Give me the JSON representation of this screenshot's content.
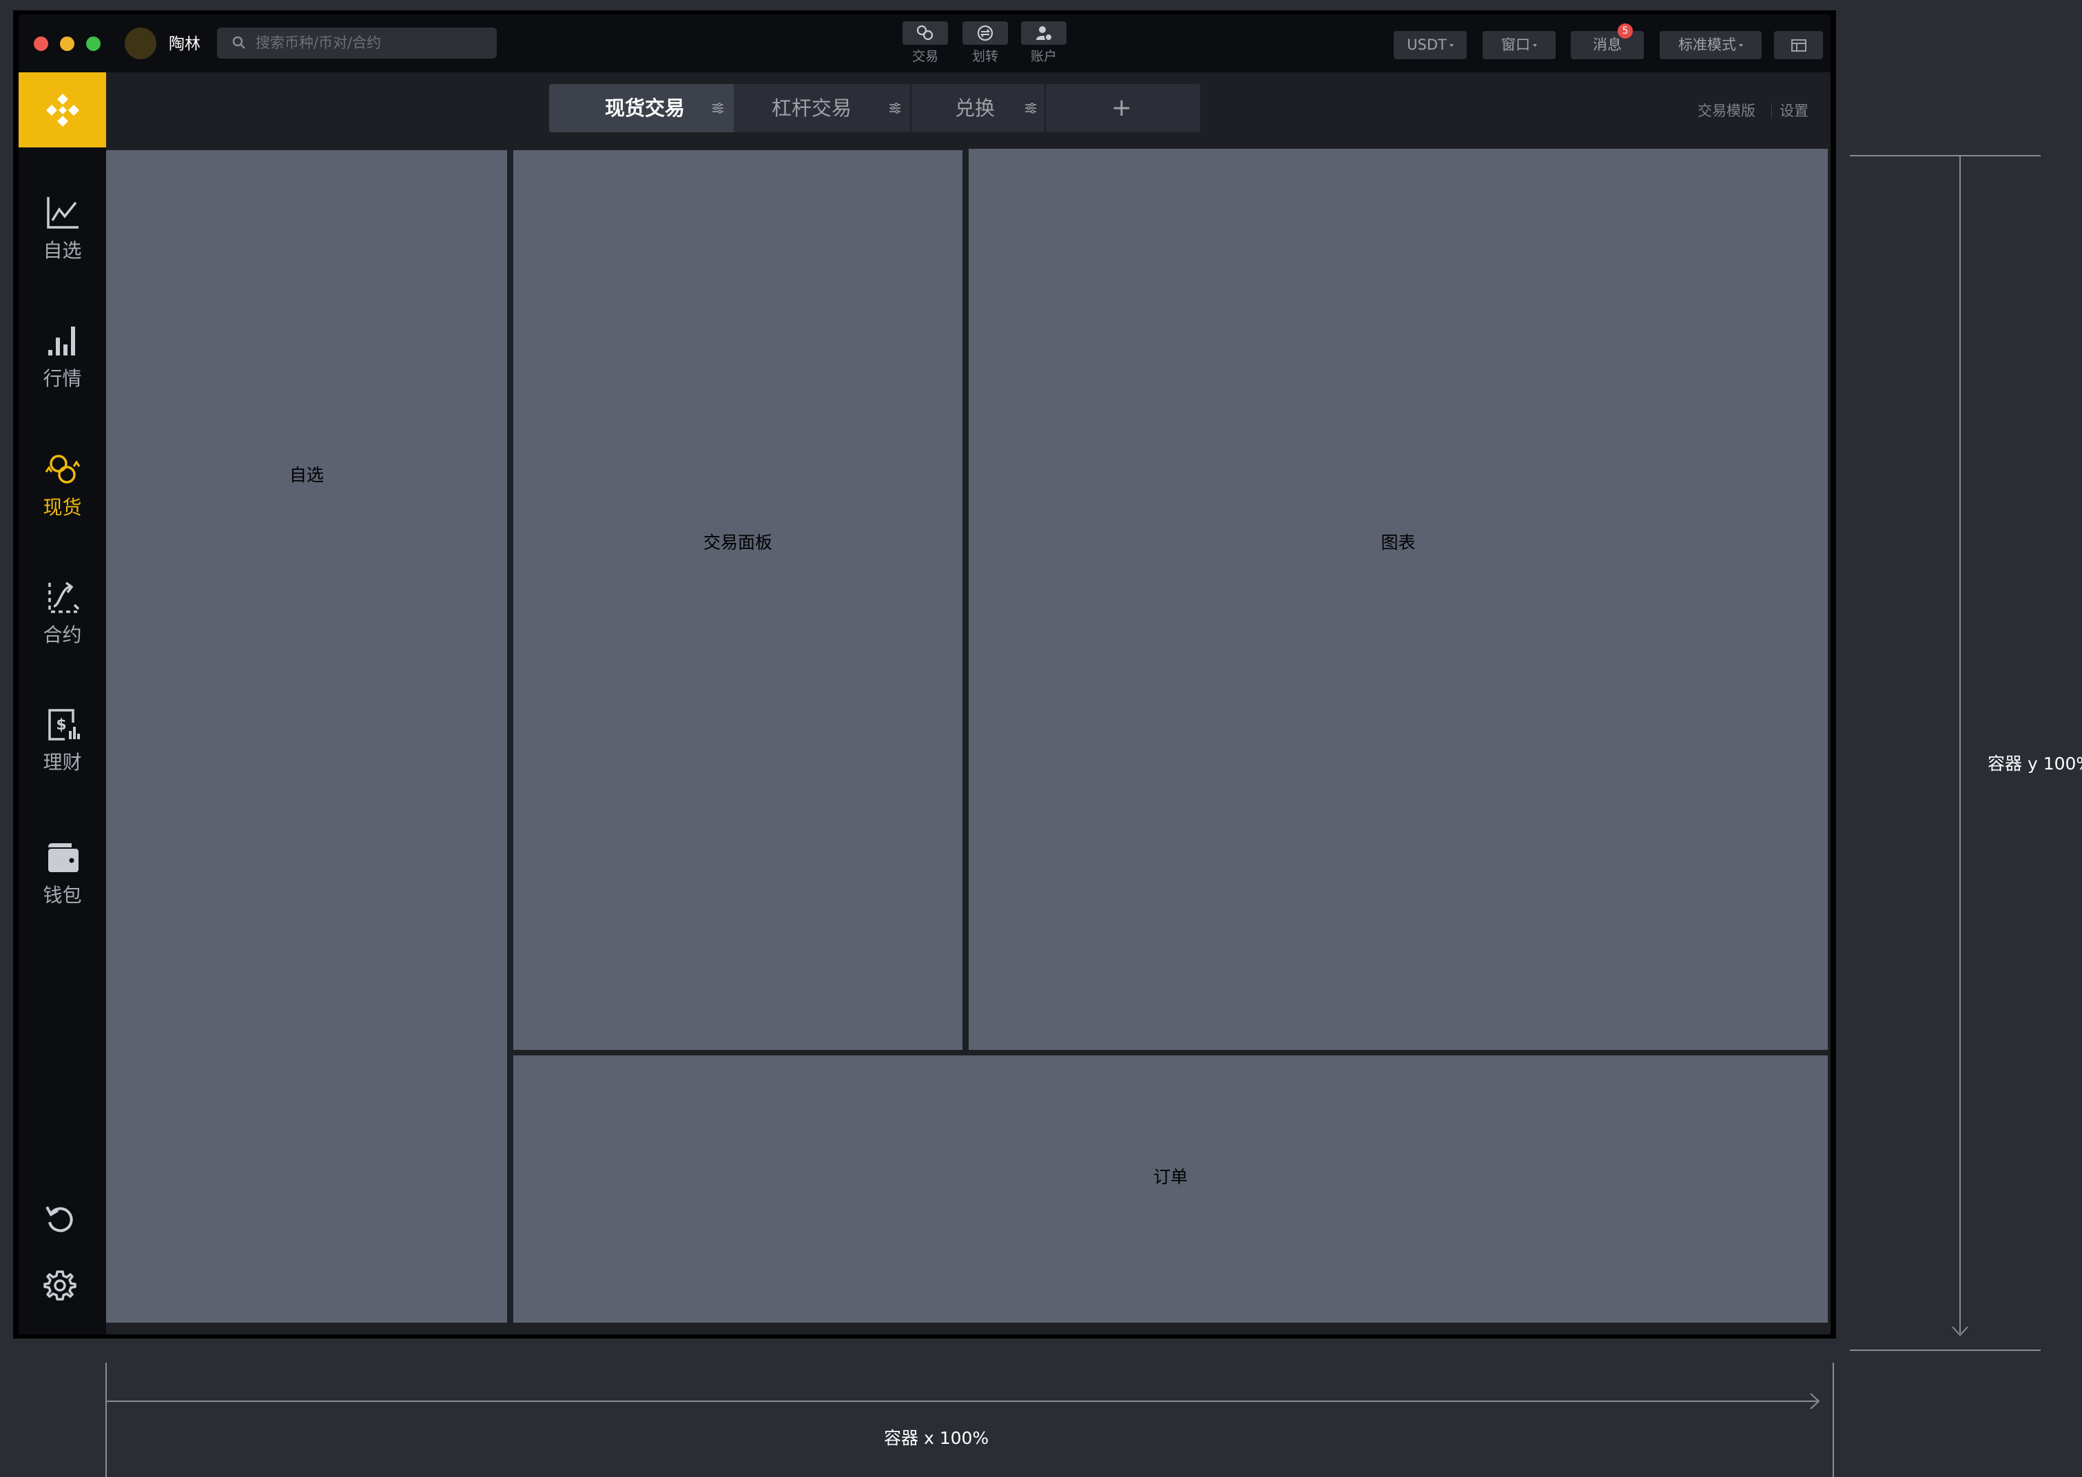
{
  "titlebar": {
    "username": "陶林",
    "search_placeholder": "搜索币种/币对/合约",
    "nav": [
      {
        "label": "交易",
        "icon": "trade-icon"
      },
      {
        "label": "划转",
        "icon": "transfer-icon"
      },
      {
        "label": "账户",
        "icon": "account-icon"
      }
    ],
    "currency_label": "USDT",
    "window_label": "窗口",
    "messages_label": "消息",
    "messages_badge": "5",
    "mode_label": "标准模式"
  },
  "sidebar": {
    "items": [
      {
        "label": "自选",
        "icon": "watchlist-chart-icon",
        "active": false
      },
      {
        "label": "行情",
        "icon": "market-bars-icon",
        "active": false
      },
      {
        "label": "现货",
        "icon": "spot-exchange-icon",
        "active": true
      },
      {
        "label": "合约",
        "icon": "futures-icon",
        "active": false
      },
      {
        "label": "理财",
        "icon": "finance-icon",
        "active": false
      },
      {
        "label": "钱包",
        "icon": "wallet-icon",
        "active": false
      }
    ]
  },
  "tabs": [
    {
      "label": "现货交易",
      "active": true
    },
    {
      "label": "杠杆交易",
      "active": false
    },
    {
      "label": "兑换",
      "active": false
    }
  ],
  "add_tab_label": "+",
  "header_links": {
    "template": "交易模版",
    "settings": "设置"
  },
  "panels": {
    "watchlist": "自选",
    "trade_panel": "交易面板",
    "chart": "图表",
    "orders": "订单"
  },
  "annotations": {
    "y_label": "容器 y 100%",
    "x_label": "容器 x 100%"
  },
  "colors": {
    "accent": "#f0b90b",
    "panel": "#5c6270",
    "window_bg": "#0c0d11",
    "badge": "#e84b4b"
  }
}
